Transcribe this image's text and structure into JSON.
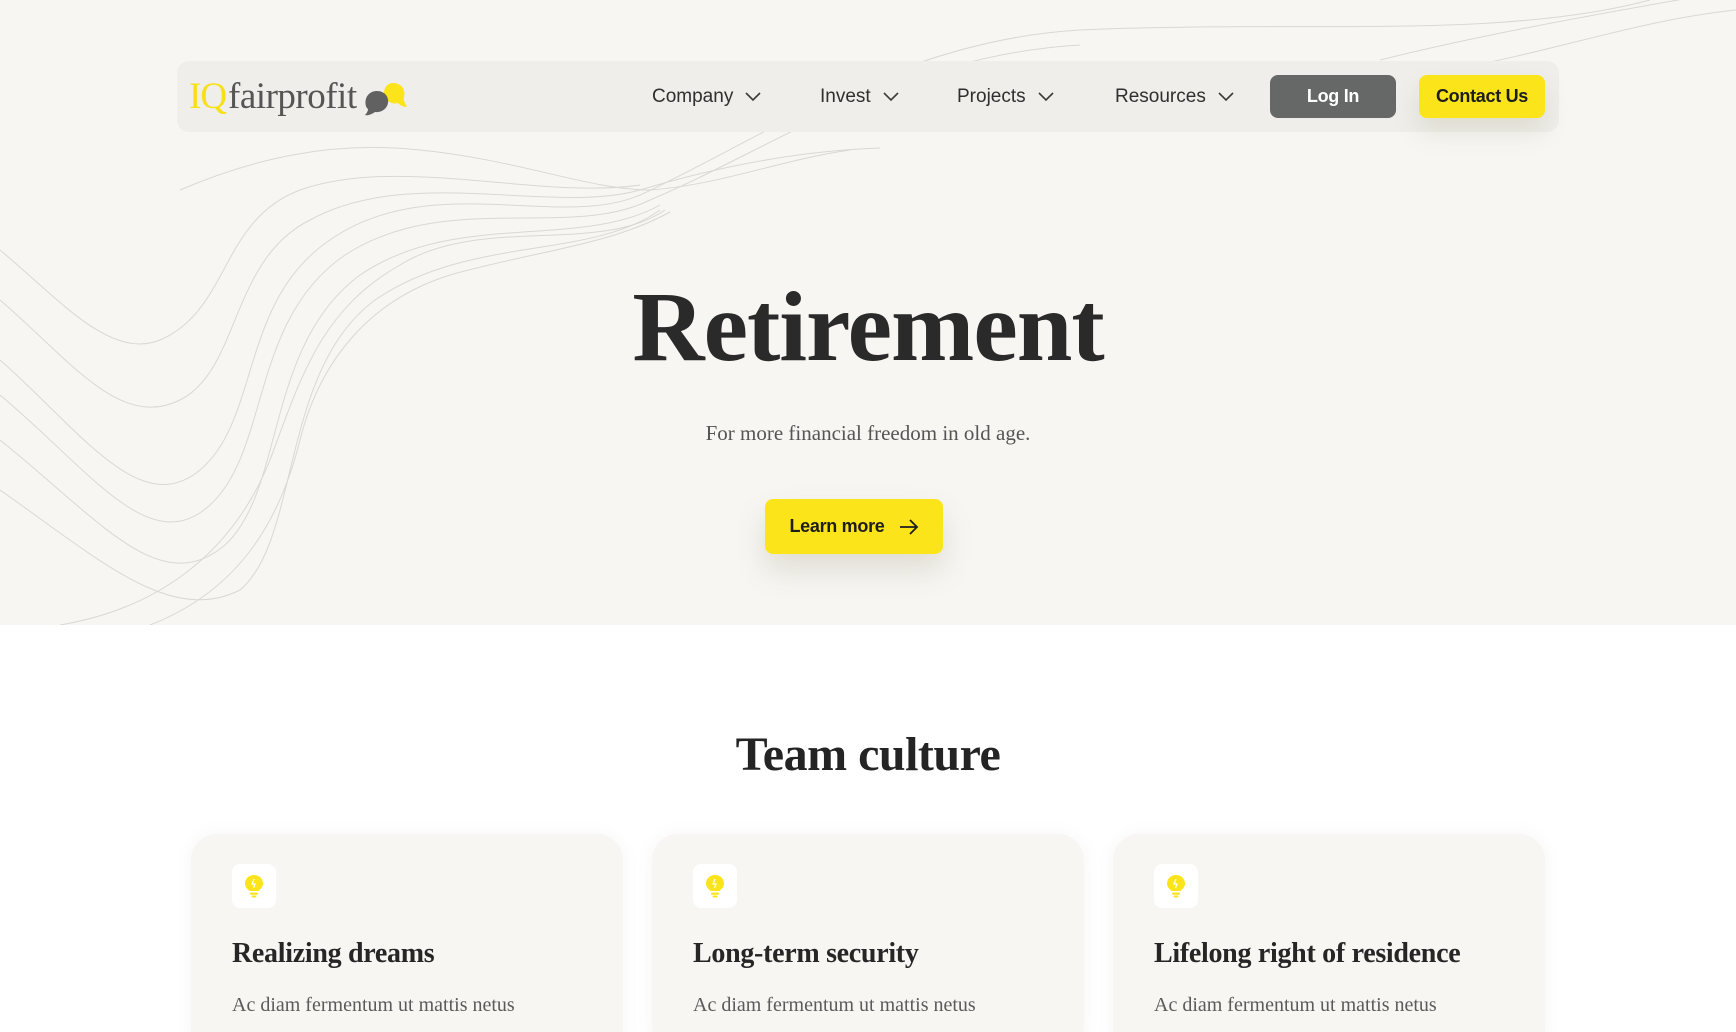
{
  "brand": {
    "logo_prefix": "IQ",
    "logo_word": "fairprofit",
    "accent_color": "#fbe41a",
    "dark_button_color": "#666767"
  },
  "nav": {
    "items": [
      {
        "label": "Company",
        "icon": "chevron-down-icon"
      },
      {
        "label": "Invest",
        "icon": "chevron-down-icon"
      },
      {
        "label": "Projects",
        "icon": "chevron-down-icon"
      },
      {
        "label": "Resources",
        "icon": "chevron-down-icon"
      }
    ],
    "login_label": "Log In",
    "contact_label": "Contact Us"
  },
  "hero": {
    "title": "Retirement",
    "subtitle": "For more financial freedom in old age.",
    "cta_label": "Learn more",
    "cta_icon": "arrow-right-icon"
  },
  "team": {
    "title": "Team culture",
    "cards": [
      {
        "icon": "lightbulb-icon",
        "title": "Realizing dreams",
        "text": "Ac diam fermentum ut mattis netus"
      },
      {
        "icon": "lightbulb-icon",
        "title": "Long-term security",
        "text": "Ac diam fermentum ut mattis netus"
      },
      {
        "icon": "lightbulb-icon",
        "title": "Lifelong right of residence",
        "text": "Ac diam fermentum ut mattis netus"
      }
    ]
  }
}
